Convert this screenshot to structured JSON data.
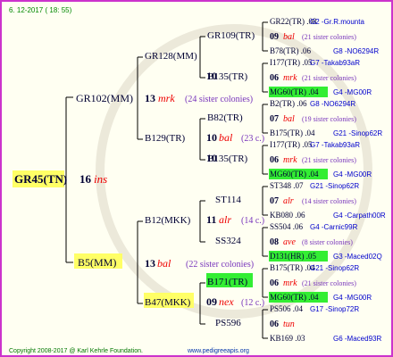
{
  "header": {
    "date": "6. 12-2017 ( 18: 55)"
  },
  "footer": {
    "copyright": "Copyright 2008-2017 @ Karl Kehrle Foundation.",
    "website": "www.pedigreeapis.org"
  },
  "colors": {
    "frame": "#cc33cc",
    "paper": "#fffff2",
    "highlight_yellow": "#ffff66",
    "highlight_green": "#33ee33",
    "info_blue": "#0000cc",
    "sister_purple": "#7733bb",
    "mark_red": "#ee0000",
    "text_dark": "#000033",
    "footer_green": "#007700",
    "date_green": "#008800"
  },
  "root": {
    "name": "GR45(TN)",
    "num": "16",
    "tag": "ins"
  },
  "sire": {
    "name": "GR102(MM)",
    "num": "13",
    "tag": "mrk",
    "sisters": "(24 sister colonies)"
  },
  "dam": {
    "name": "B5(MM)",
    "num": "13",
    "tag": "bal",
    "sisters": "(22 sister colonies)"
  },
  "grand": [
    {
      "name": "GR128(MM)"
    },
    {
      "name": "B129(TR)",
      "num": "10",
      "tag": "bal",
      "sisters": "(23 c.)"
    },
    {
      "name": "B12(MKK)",
      "num": "11",
      "tag": "alr",
      "sisters": "(14 c.)"
    },
    {
      "name": "B47(MKK)",
      "num": "09",
      "tag": "nex",
      "sisters": "(12 c.)"
    }
  ],
  "great": [
    {
      "name": "GR109(TR)"
    },
    {
      "name": "B135(TR)",
      "num": "10",
      "tag": "bal",
      "sisters": "(23 c.)"
    },
    {
      "name": "B82(TR)"
    },
    {
      "name": "B135(TR)",
      "num": "10",
      "tag": "bal",
      "sisters": "(23 c.)"
    },
    {
      "name": "ST114"
    },
    {
      "name": "SS324"
    },
    {
      "name": "B171(TR)"
    },
    {
      "name": "PS596"
    }
  ],
  "ggs": [
    {
      "sire": "GR22(TR) .08",
      "sire_info": "G2 -Gr.R.mounta",
      "num": "09",
      "tag": "bal",
      "sisters": "(21 sister colonies)",
      "dam": "B78(TR) .06",
      "dam_info": "G8 -NO6294R"
    },
    {
      "sire": "I177(TR) .05",
      "sire_info": "G7 -Takab93aR",
      "num": "06",
      "tag": "mrk",
      "sisters": "(21 sister colonies)",
      "dam": "MG60(TR) .04",
      "dam_info": "G4 -MG00R"
    },
    {
      "sire": "B2(TR) .06",
      "sire_info": "G8 -NO6294R",
      "num": "07",
      "tag": "bal",
      "sisters": "(19 sister colonies)",
      "dam": "B175(TR) .04",
      "dam_info": "G21 -Sinop62R"
    },
    {
      "sire": "I177(TR) .05",
      "sire_info": "G7 -Takab93aR",
      "num": "06",
      "tag": "mrk",
      "sisters": "(21 sister colonies)",
      "dam": "MG60(TR) .04",
      "dam_info": "G4 -MG00R"
    },
    {
      "sire": "ST348 .07",
      "sire_info": "G21 -Sinop62R",
      "num": "07",
      "tag": "alr",
      "sisters": "(14 sister colonies)",
      "dam": "KB080 .06",
      "dam_info": "G4 -Carpath00R"
    },
    {
      "sire": "SS504 .06",
      "sire_info": "G4 -Carnic99R",
      "num": "08",
      "tag": "ave",
      "sisters": "(8 sister colonies)",
      "dam": "D131(HR) .05",
      "dam_info": "G3 -Maced02Q"
    },
    {
      "sire": "B175(TR) .04",
      "sire_info": "G21 -Sinop62R",
      "num": "06",
      "tag": "mrk",
      "sisters": "(21 sister colonies)",
      "dam": "MG60(TR) .04",
      "dam_info": "G4 -MG00R"
    },
    {
      "sire": "PS506 .04",
      "sire_info": "G17 -Sinop72R",
      "num": "06",
      "tag": "tun",
      "sisters": "",
      "dam": "KB169 .03",
      "dam_info": "G6 -Maced93R"
    }
  ]
}
